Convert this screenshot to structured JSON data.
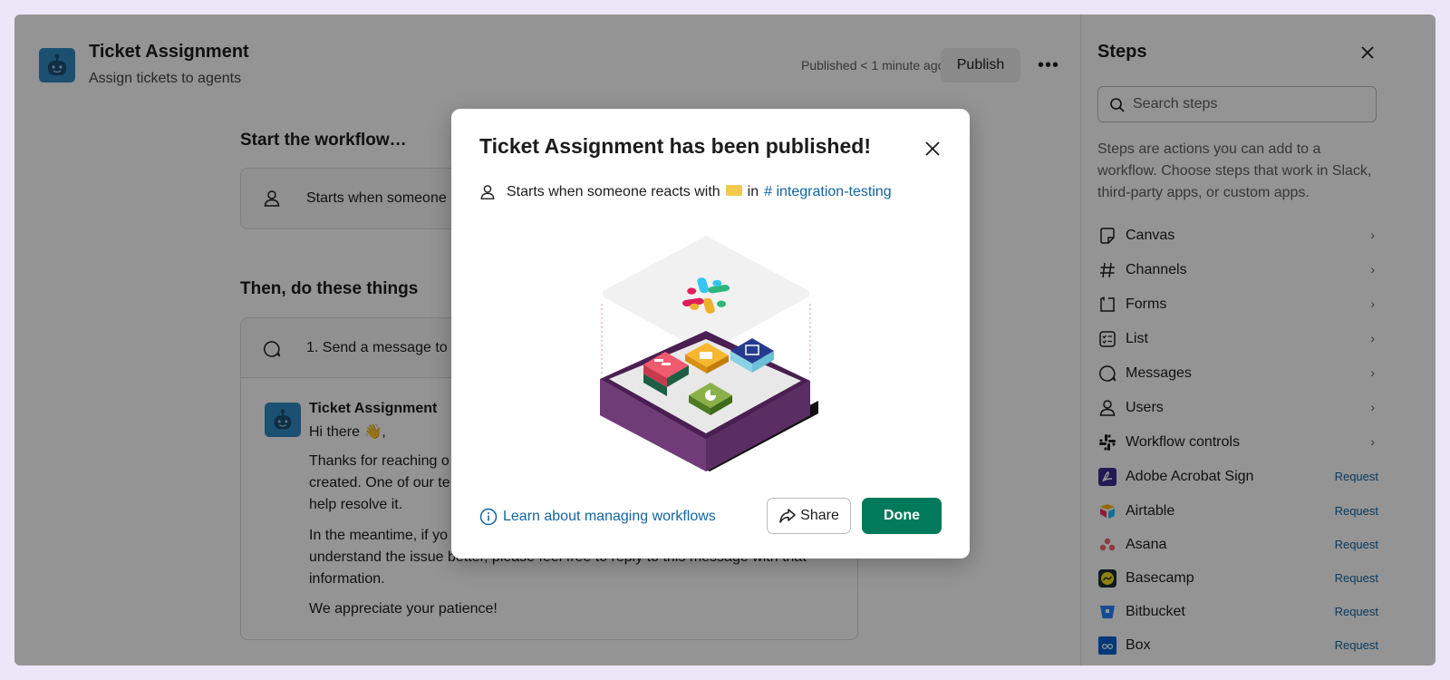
{
  "workflow": {
    "title": "Ticket Assignment",
    "subtitle": "Assign tickets to agents",
    "status": "Published < 1 minute ago",
    "publish_label": "Publish",
    "more_label": "•••"
  },
  "main": {
    "start_heading": "Start the workflow…",
    "trigger_text": "Starts when someone",
    "then_heading": "Then, do these things",
    "step1_text": "1. Send a message to",
    "message": {
      "author": "Ticket Assignment",
      "greeting": "Hi there 👋,",
      "para1_line1": "Thanks for reaching o",
      "para1_line2": "created. One of our te",
      "para1_line3": "help resolve it.",
      "para2_line1": "In the meantime, if yo",
      "para2_line2": "understand the issue better, please feel free to reply to this message with that",
      "para2_line3": "information.",
      "closing": "We appreciate your patience!"
    }
  },
  "panel": {
    "title": "Steps",
    "search_placeholder": "Search steps",
    "description": "Steps are actions you can add to a workflow. Choose steps that work in Slack, third-party apps, or custom apps.",
    "categories": [
      {
        "label": "Canvas",
        "icon": "canvas-icon"
      },
      {
        "label": "Channels",
        "icon": "hash-icon"
      },
      {
        "label": "Forms",
        "icon": "form-icon"
      },
      {
        "label": "List",
        "icon": "list-icon"
      },
      {
        "label": "Messages",
        "icon": "message-icon"
      },
      {
        "label": "Users",
        "icon": "user-icon"
      },
      {
        "label": "Workflow controls",
        "icon": "slack-icon"
      }
    ],
    "apps": [
      {
        "label": "Adobe Acrobat Sign",
        "action": "Request",
        "color": "#3b2e8e"
      },
      {
        "label": "Airtable",
        "action": "Request",
        "color": "#f8b400"
      },
      {
        "label": "Asana",
        "action": "Request",
        "color": "#f06a6a"
      },
      {
        "label": "Basecamp",
        "action": "Request",
        "color": "#f5e11d"
      },
      {
        "label": "Bitbucket",
        "action": "Request",
        "color": "#2684ff"
      },
      {
        "label": "Box",
        "action": "Request",
        "color": "#0061d5"
      }
    ]
  },
  "modal": {
    "title": "Ticket Assignment has been published!",
    "trigger_prefix": "Starts when someone reacts with",
    "trigger_in": "in",
    "channel": "# integration-testing",
    "learn_link": "Learn about managing workflows",
    "share_label": "Share",
    "done_label": "Done"
  },
  "colors": {
    "accent_green": "#007a5a",
    "link_blue": "#1264a3",
    "bot_avatar": "#2f8ac4",
    "background": "#ece6f9"
  }
}
